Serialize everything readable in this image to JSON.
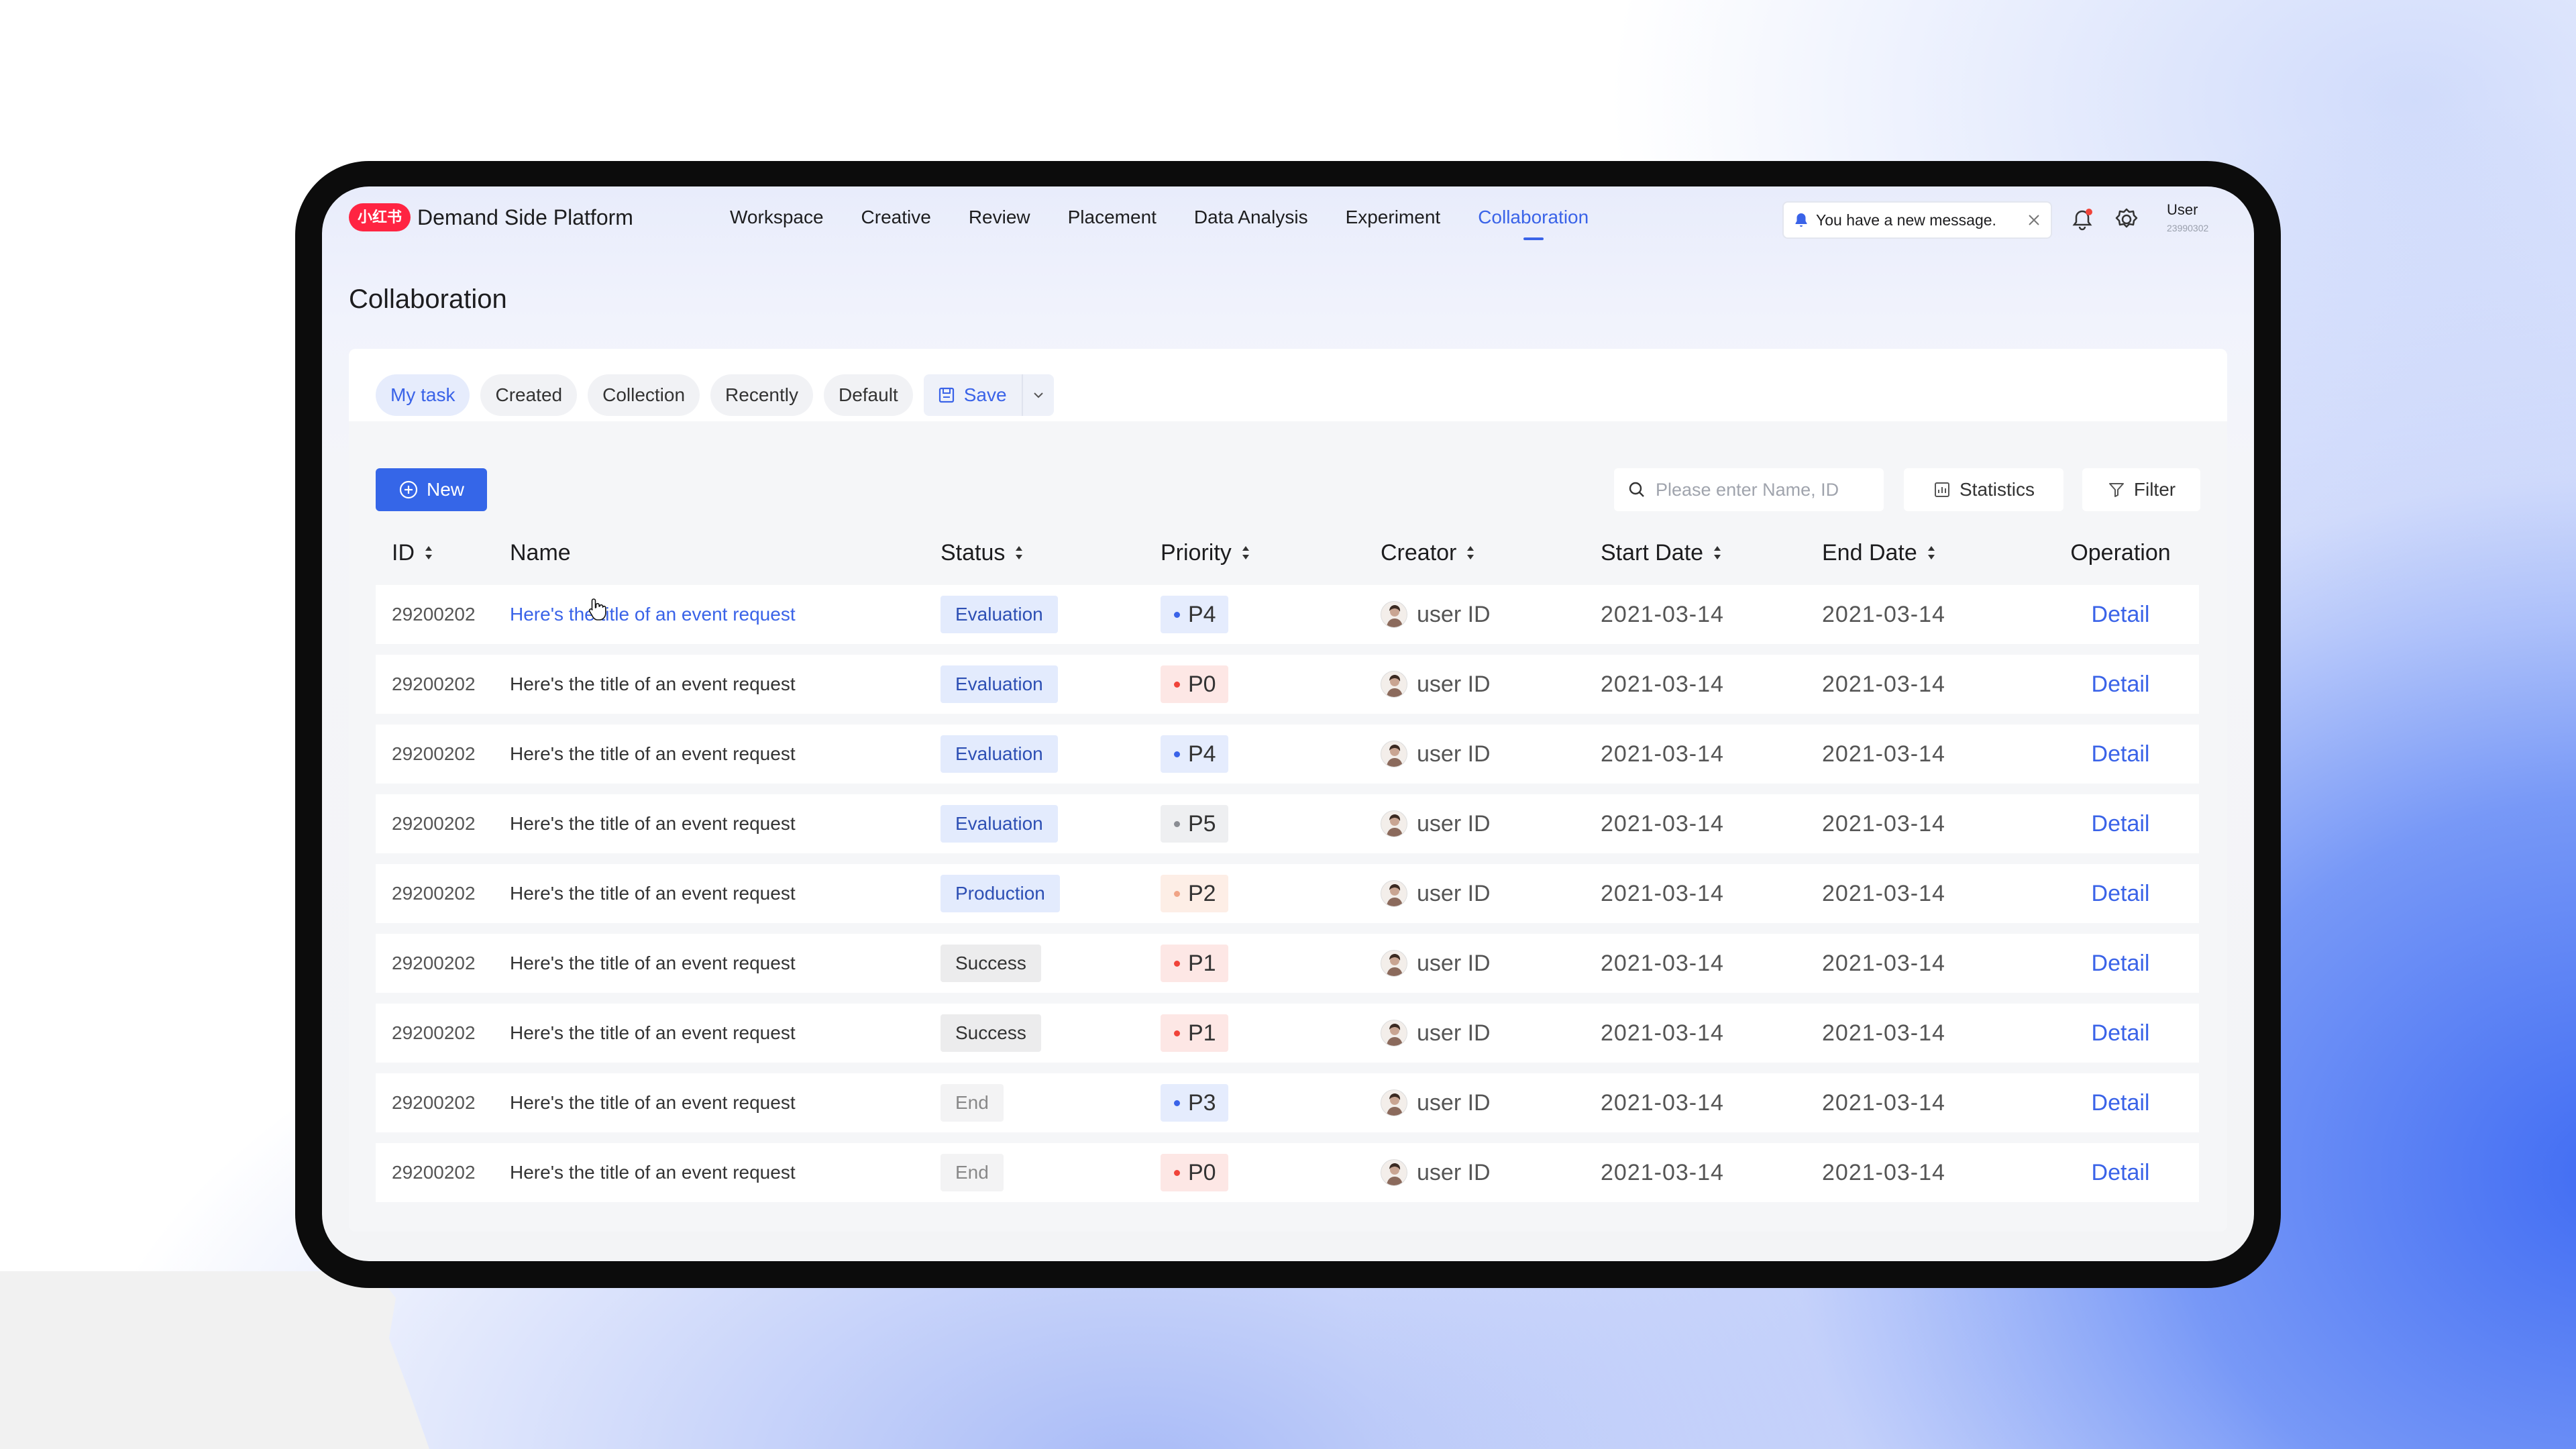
{
  "header": {
    "logo_text": "小红书",
    "app_title": "Demand Side Platform",
    "nav": [
      "Workspace",
      "Creative",
      "Review",
      "Placement",
      "Data Analysis",
      "Experiment",
      "Collaboration"
    ],
    "active_nav": "Collaboration",
    "notification": "You have a new message.",
    "user_name": "User",
    "user_id": "23990302"
  },
  "page_title": "Collaboration",
  "tabs": [
    "My task",
    "Created",
    "Collection",
    "Recently",
    "Default"
  ],
  "active_tab": "My task",
  "save_label": "Save",
  "new_label": "New",
  "search_placeholder": "Please enter Name, ID",
  "statistics_label": "Statistics",
  "filter_label": "Filter",
  "columns": [
    "ID",
    "Name",
    "Status",
    "Priority",
    "Creator",
    "Start Date",
    "End Date",
    "Operation"
  ],
  "rows": [
    {
      "id": "29200202",
      "name": "Here's the title of an event request",
      "status": "Evaluation",
      "priority": "P4",
      "creator": "user ID",
      "start": "2021-03-14",
      "end": "2021-03-14",
      "op": "Detail"
    },
    {
      "id": "29200202",
      "name": "Here's the title of an event request",
      "status": "Evaluation",
      "priority": "P0",
      "creator": "user ID",
      "start": "2021-03-14",
      "end": "2021-03-14",
      "op": "Detail"
    },
    {
      "id": "29200202",
      "name": "Here's the title of an event request",
      "status": "Evaluation",
      "priority": "P4",
      "creator": "user ID",
      "start": "2021-03-14",
      "end": "2021-03-14",
      "op": "Detail"
    },
    {
      "id": "29200202",
      "name": "Here's the title of an event request",
      "status": "Evaluation",
      "priority": "P5",
      "creator": "user ID",
      "start": "2021-03-14",
      "end": "2021-03-14",
      "op": "Detail"
    },
    {
      "id": "29200202",
      "name": "Here's the title of an event request",
      "status": "Production",
      "priority": "P2",
      "creator": "user ID",
      "start": "2021-03-14",
      "end": "2021-03-14",
      "op": "Detail"
    },
    {
      "id": "29200202",
      "name": "Here's the title of an event request",
      "status": "Success",
      "priority": "P1",
      "creator": "user ID",
      "start": "2021-03-14",
      "end": "2021-03-14",
      "op": "Detail"
    },
    {
      "id": "29200202",
      "name": "Here's the title of an event request",
      "status": "Success",
      "priority": "P1",
      "creator": "user ID",
      "start": "2021-03-14",
      "end": "2021-03-14",
      "op": "Detail"
    },
    {
      "id": "29200202",
      "name": "Here's the title of an event request",
      "status": "End",
      "priority": "P3",
      "creator": "user ID",
      "start": "2021-03-14",
      "end": "2021-03-14",
      "op": "Detail"
    },
    {
      "id": "29200202",
      "name": "Here's the title of an event request",
      "status": "End",
      "priority": "P0",
      "creator": "user ID",
      "start": "2021-03-14",
      "end": "2021-03-14",
      "op": "Detail"
    }
  ],
  "priority_colors": {
    "P0": {
      "dot": "#f0443a",
      "bg": "#fde7e5"
    },
    "P1": {
      "dot": "#f0443a",
      "bg": "#fde7e5"
    },
    "P2": {
      "dot": "#f0a486",
      "bg": "#fdeee6"
    },
    "P3": {
      "dot": "#3a63e8",
      "bg": "#e5ecfd"
    },
    "P4": {
      "dot": "#3a63e8",
      "bg": "#e5ecfd"
    },
    "P5": {
      "dot": "#8a8d93",
      "bg": "#eeeff1"
    }
  },
  "status_classes": {
    "Evaluation": "b-eval",
    "Production": "b-prod",
    "Success": "b-succ",
    "End": "b-end"
  },
  "colors": {
    "accent": "#3a63e8",
    "brand": "#ff2442"
  },
  "icons": [
    "bell-icon",
    "close-icon",
    "notification-icon",
    "gear-icon",
    "save-icon",
    "chevron-down-icon",
    "plus-circle-icon",
    "search-icon",
    "chart-icon",
    "filter-icon",
    "sort-icon",
    "avatar"
  ]
}
